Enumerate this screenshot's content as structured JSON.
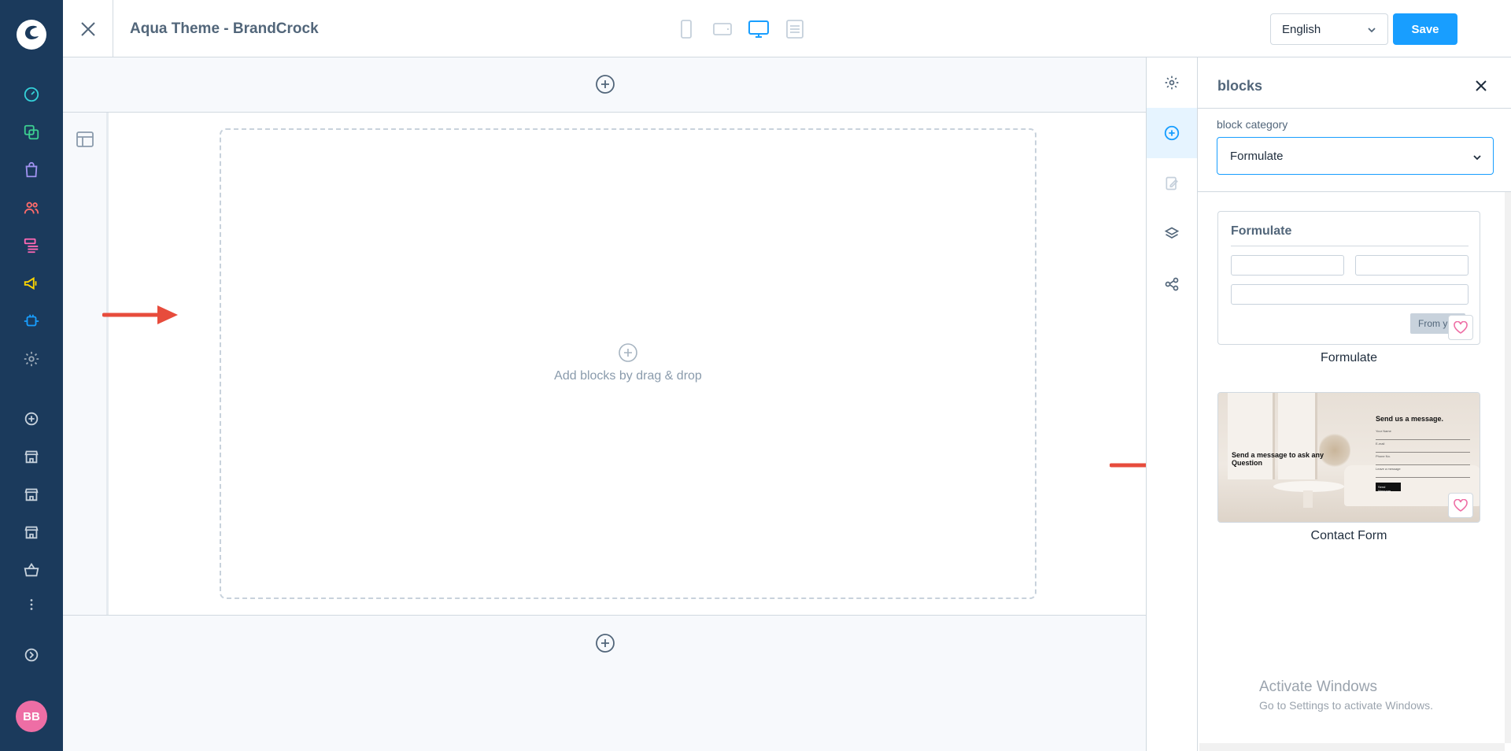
{
  "editor": {
    "title": "Aqua Theme - BrandCrock",
    "language": "English",
    "save_label": "Save",
    "accent_color": "#189eff"
  },
  "admin_sidebar": {
    "background_color": "#1b3a5c",
    "avatar_initials": "BB",
    "avatar_color": "#ee6ea5",
    "icons": [
      "dashboard-icon",
      "catalogues-icon",
      "orders-icon",
      "customers-icon",
      "content-icon",
      "marketing-icon",
      "extensions-icon",
      "settings-icon",
      "add-sales-channel-icon",
      "storefront-icon",
      "storefront-icon",
      "storefront-icon",
      "headless-icon",
      "more-icon",
      "expand-icon"
    ]
  },
  "canvas": {
    "dropzone_text": "Add blocks by drag & drop"
  },
  "blocks_panel": {
    "title": "blocks",
    "category_label": "block category",
    "category_value": "Formulate",
    "blocks": [
      {
        "name": "Formulate",
        "preview_title": "Formulate",
        "preview_button": "From y"
      },
      {
        "name": "Contact Form",
        "preview_headline": "Send a message to ask any Question",
        "preview_form_title": "Send us a message.",
        "preview_fields": [
          "Your Name",
          "E-mail",
          "Phone No.",
          "Leave a message"
        ],
        "preview_submit": "Send Message"
      }
    ]
  },
  "system_overlay": {
    "line1": "Activate Windows",
    "line2": "Go to Settings to activate Windows."
  }
}
